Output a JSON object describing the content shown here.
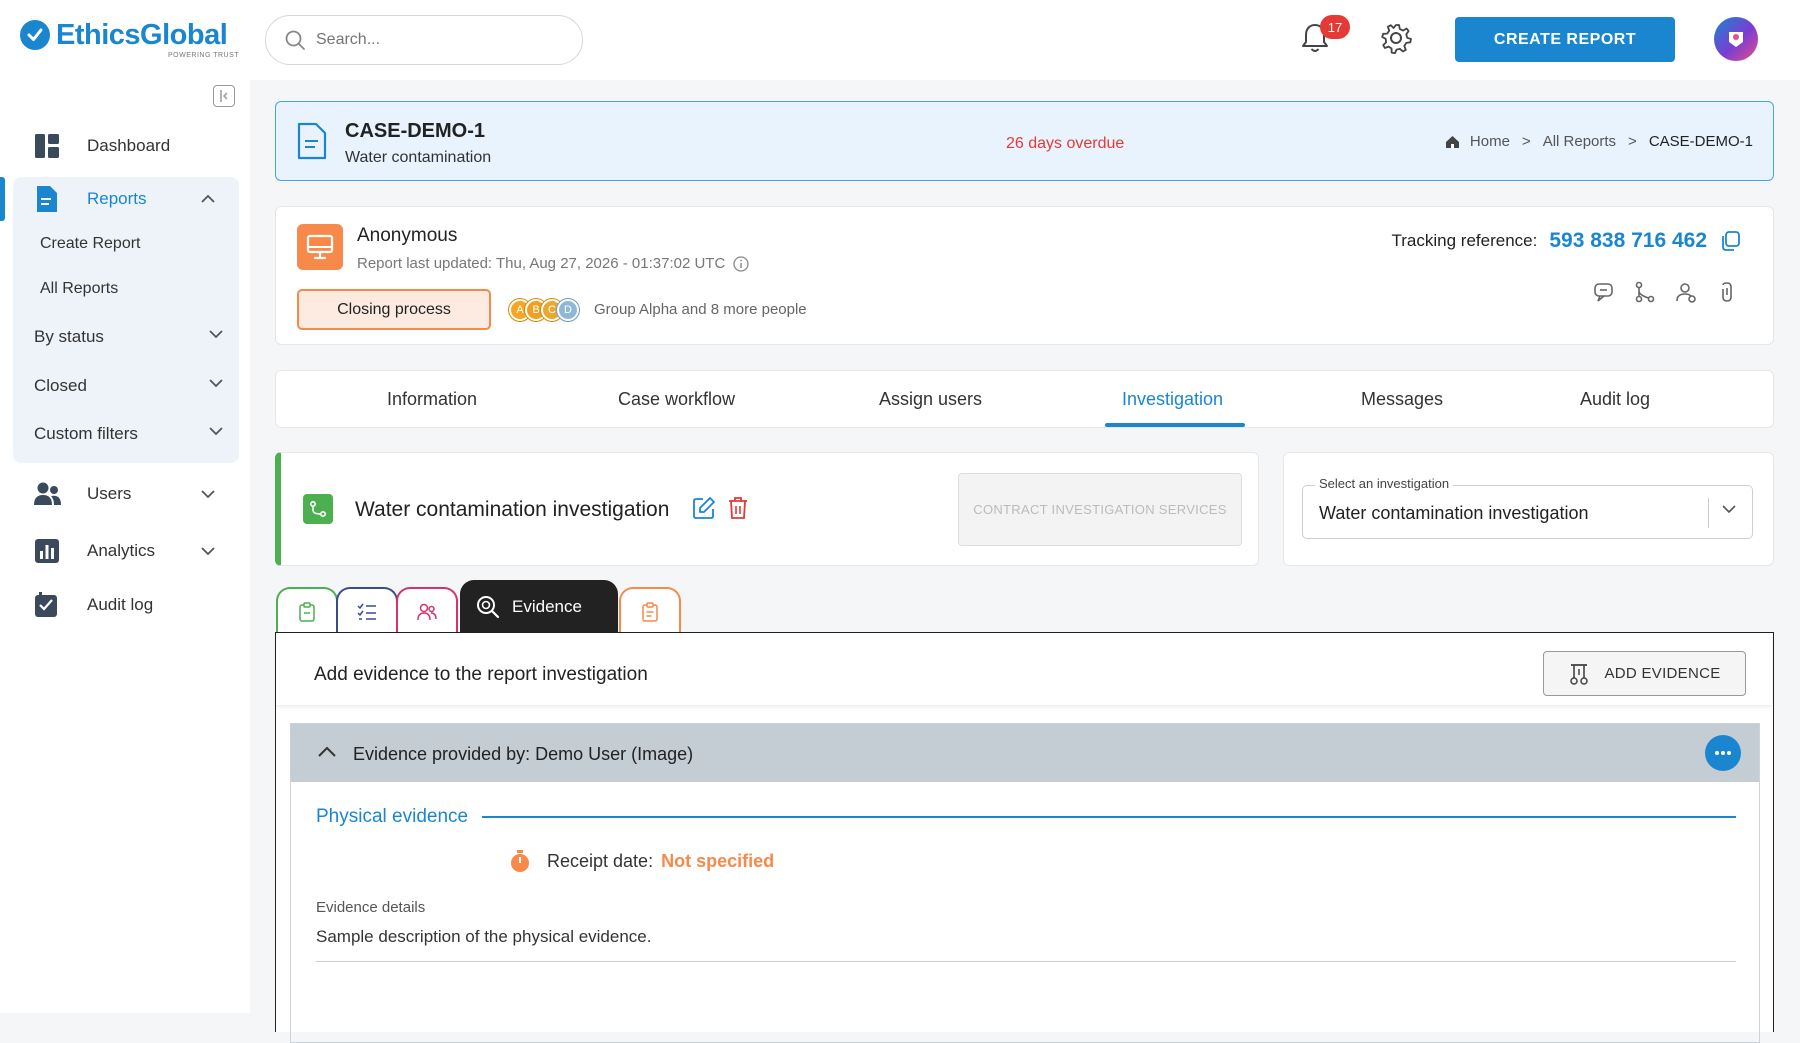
{
  "brand": {
    "name": "EthicsGlobal",
    "tagline": "POWERING TRUST"
  },
  "header": {
    "search_placeholder": "Search...",
    "notification_count": "17",
    "create_report_label": "CREATE REPORT"
  },
  "sidebar": {
    "dashboard": "Dashboard",
    "reports": "Reports",
    "create_report": "Create Report",
    "all_reports": "All Reports",
    "by_status": "By status",
    "closed": "Closed",
    "custom_filters": "Custom filters",
    "users": "Users",
    "analytics": "Analytics",
    "audit_log": "Audit log"
  },
  "case": {
    "id": "CASE-DEMO-1",
    "subtitle": "Water contamination",
    "overdue": "26 days overdue",
    "breadcrumb": {
      "home": "Home",
      "sep": ">",
      "all_reports": "All Reports",
      "current": "CASE-DEMO-1"
    }
  },
  "reporter": {
    "name": "Anonymous",
    "updated": "Report last updated: Thu, Aug 27, 2026 - 01:37:02 UTC",
    "status_label": "Closing process",
    "bubbles": [
      "A",
      "B",
      "C",
      "D"
    ],
    "group_text": "Group Alpha and 8 more people",
    "tracking_label": "Tracking reference:",
    "tracking_value": "593 838 716 462"
  },
  "tabs": [
    "Information",
    "Case workflow",
    "Assign users",
    "Investigation",
    "Messages",
    "Audit log"
  ],
  "investigation": {
    "title": "Water contamination investigation",
    "contract_button": "CONTRACT INVESTIGATION SERVICES",
    "select_label": "Select an investigation",
    "select_value": "Water contamination investigation"
  },
  "subtabs": {
    "active_label": "Evidence"
  },
  "evidence": {
    "header_title": "Add evidence to the report investigation",
    "add_button": "ADD EVIDENCE",
    "item_title": "Evidence provided by: Demo User (Image)",
    "section_title": "Physical evidence",
    "receipt_label": "Receipt date:",
    "receipt_value": "Not specified",
    "details_label": "Evidence details",
    "details_value": "Sample description of the physical evidence."
  },
  "colors": {
    "accent": "#1a86d0",
    "overdue": "#e53935",
    "orange": "#f7894a",
    "green": "#4caf50"
  }
}
